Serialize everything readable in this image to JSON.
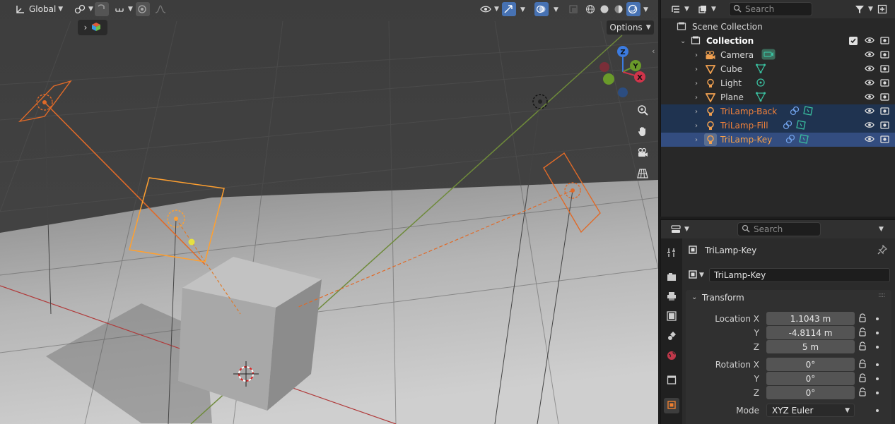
{
  "viewport": {
    "transform_orientation": "Global",
    "options_label": "Options",
    "gizmo": {
      "z": "Z",
      "y": "Y",
      "x": "X"
    }
  },
  "outliner": {
    "search_placeholder": "Search",
    "scene_collection": "Scene Collection",
    "collection": "Collection",
    "items": [
      {
        "name": "Camera",
        "type": "camera",
        "color": "#d6d6d6",
        "state": "normal"
      },
      {
        "name": "Cube",
        "type": "mesh",
        "color": "#d6d6d6",
        "state": "normal"
      },
      {
        "name": "Light",
        "type": "light",
        "color": "#d6d6d6",
        "state": "normal"
      },
      {
        "name": "Plane",
        "type": "mesh",
        "color": "#d6d6d6",
        "state": "normal"
      },
      {
        "name": "TriLamp-Back",
        "type": "light",
        "color": "#f0813a",
        "state": "selected"
      },
      {
        "name": "TriLamp-Fill",
        "type": "light",
        "color": "#f0813a",
        "state": "selected"
      },
      {
        "name": "TriLamp-Key",
        "type": "light",
        "color": "#f5a04a",
        "state": "active"
      }
    ]
  },
  "properties": {
    "search_placeholder": "Search",
    "object_name_header": "TriLamp-Key",
    "object_name_field": "TriLamp-Key",
    "transform_label": "Transform",
    "location_label": "Location X",
    "rotation_label": "Rotation X",
    "axis_y": "Y",
    "axis_z": "Z",
    "location": [
      "1.1043 m",
      "-4.8114 m",
      "5 m"
    ],
    "rotation": [
      "0°",
      "0°",
      "0°"
    ],
    "mode_label": "Mode",
    "mode_value": "XYZ Euler"
  },
  "colors": {
    "selected_orange": "#f0813a",
    "active_orange": "#ffaa40",
    "accent_blue": "#4772b3"
  }
}
